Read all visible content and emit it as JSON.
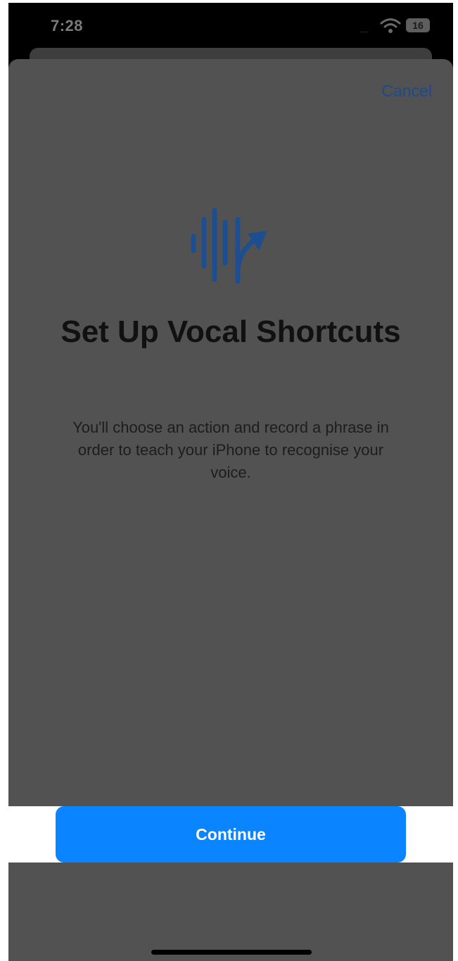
{
  "status_bar": {
    "time": "7:28",
    "signal": "....",
    "battery_level": "16"
  },
  "sheet": {
    "cancel_label": "Cancel",
    "hero_icon": "vocal-shortcuts-waveform-arrow-icon",
    "title": "Set Up Vocal Shortcuts",
    "description": "You'll choose an action and record a phrase in order to teach your iPhone to recognise your voice.",
    "continue_label": "Continue"
  },
  "colors": {
    "accent_blue": "#0a84ff",
    "cancel_text": "#1c4a8f",
    "icon_blue": "#1d4e91",
    "sheet_background": "#525252"
  }
}
